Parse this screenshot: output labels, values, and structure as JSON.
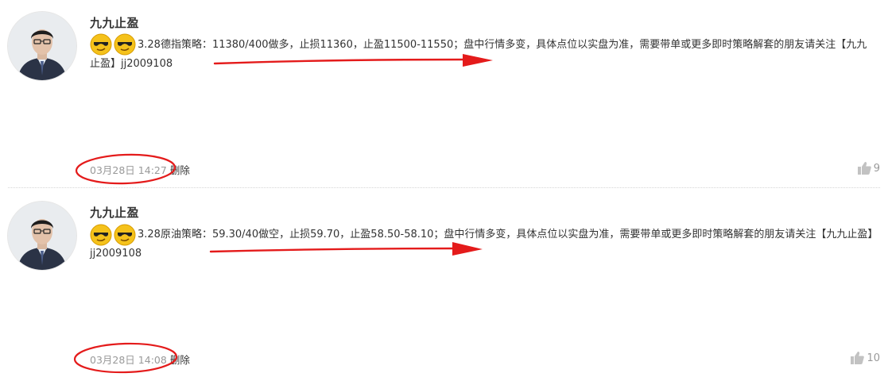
{
  "posts": [
    {
      "author": "九九止盈",
      "emojis": [
        "sunglasses-emoji-icon",
        "sunglasses-emoji-icon"
      ],
      "text": "3.28德指策略：11380/400做多，止损11360，止盈11500-11550；盘中行情多变，具体点位以实盘为准，需要带单或更多即时策略解套的朋友请关注【九九止盈】jj2009108",
      "time": "03月28日 14:27",
      "delete_label": "删除",
      "likes": "9"
    },
    {
      "author": "九九止盈",
      "emojis": [
        "sunglasses-emoji-icon",
        "sunglasses-emoji-icon"
      ],
      "text": "3.28原油策略：59.30/40做空，止损59.70，止盈58.50-58.10；盘中行情多变，具体点位以实盘为准，需要带单或更多即时策略解套的朋友请关注【九九止盈】jj2009108",
      "time": "03月28日 14:08",
      "delete_label": "删除",
      "likes": "10"
    }
  ],
  "colors": {
    "annotation": "#e41b1b",
    "muted": "#999999",
    "divider": "#d6d6d6",
    "emoji_face": "#f5c21b"
  }
}
